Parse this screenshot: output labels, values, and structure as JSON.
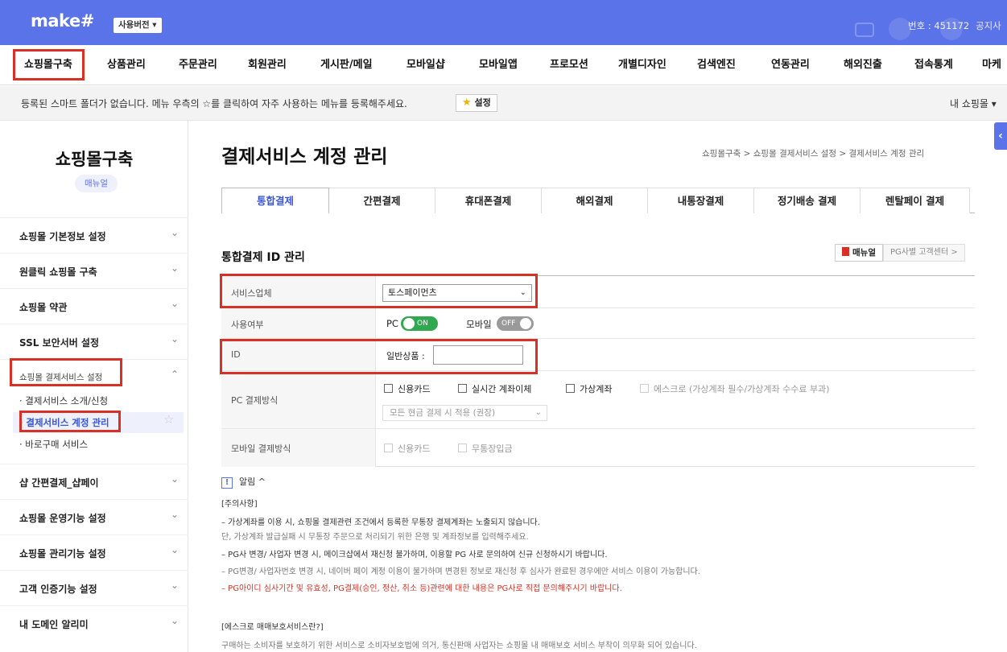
{
  "topbar": {
    "logo": "make#",
    "version_badge": "사용버전 ▾",
    "number": "번호 : 451172",
    "notice": "공지사"
  },
  "mainnav": {
    "items": [
      "쇼핑몰구축",
      "상품관리",
      "주문관리",
      "회원관리",
      "게시판/메일",
      "모바일샵",
      "모바일앱",
      "프로모션",
      "개별디자인",
      "검색엔진",
      "연동관리",
      "해외진출",
      "접속통계",
      "마케"
    ]
  },
  "smartbar": {
    "message": "등록된 스마트 폴더가 없습니다. 메뉴 우측의 ☆를 클릭하여 자주 사용하는 메뉴를 등록해주세요.",
    "setting_label": "설정",
    "my_shop": "내 쇼핑몰 ▾",
    "collapse_icon": "‹"
  },
  "sidebar": {
    "title": "쇼핑몰구축",
    "manual": "매뉴얼",
    "items": [
      "쇼핑몰 기본정보 설정",
      "원클릭 쇼핑몰 구축",
      "쇼핑몰 약관",
      "SSL 보안서버 설정",
      "쇼핑몰 결제서비스 설정",
      "샵 간편결제_샵페이",
      "쇼핑몰 운영기능 설정",
      "쇼핑몰 관리기능 설정",
      "고객 인증기능 설정",
      "내 도메인 알리미"
    ],
    "subitems": [
      "· 결제서비스 소개/신청",
      "· 결제서비스 계정 관리",
      "· 바로구매 서비스"
    ]
  },
  "content": {
    "title": "결제서비스 계정 관리",
    "breadcrumb": "쇼핑몰구축 > 쇼핑몰 결제서비스 설정 > 결제서비스 계정 관리",
    "tabs": [
      "통합결제",
      "간편결제",
      "휴대폰결제",
      "해외결제",
      "내통장결제",
      "정기배송 결제",
      "렌탈페이 결제"
    ],
    "section_title": "통합결제 ID 관리",
    "manual_btn": "매뉴얼",
    "pg_btn": "PG사별 고객센터 >",
    "form": {
      "service_label": "서비스업체",
      "service_value": "토스페이먼츠",
      "usage_label": "사용여부",
      "pc_label": "PC",
      "pc_toggle": "ON",
      "mobile_label": "모바일",
      "mobile_toggle": "OFF",
      "id_label": "ID",
      "id_field_label": "일반상품 :",
      "id_value": "",
      "pc_pay_label": "PC 결제방식",
      "pc_options": [
        "신용카드",
        "실시간 계좌이체",
        "가상계좌",
        "에스크로 (가상계좌 필수/가상계좌 수수료 부과)"
      ],
      "cash_receipt": "모든 현금 결제 시 적용 (권장)",
      "mobile_pay_label": "모바일 결제방식",
      "mobile_options": [
        "신용카드",
        "무통장입금"
      ]
    },
    "notes": {
      "toggle_label": "알림 ^",
      "heading": "[주의사항]",
      "lines": [
        "– 가상계좌를 이용 시, 쇼핑몰 결제관련 조건에서 등록한 무통장 결제계좌는 노출되지 않습니다.",
        "   단, 가상계좌 발급실패 시 무통장 주문으로 처리되기 위한 은행 및 계좌정보를 입력해주세요.",
        "– PG사 변경/ 사업자 변경 시, 메이크샵에서 재신청 불가하며, 이용할 PG 사로 문의하여 신규 신청하시기 바랍니다.",
        "– PG변경/ 사업자번호 변경 시, 네이버 페이 계정 이용이 불가하며 변경된 정보로 재신청 후 심사가 완료된 경우에만 서비스 이용이 가능합니다.",
        "– PG아이디 심사기간 및 유효성, PG결제(승인, 정산, 취소 등)관련에 대한 내용은 PG사로 직접 문의해주시기 바랍니다."
      ],
      "escrow_heading": "[에스크로 매매보호서비스란?]",
      "escrow_line": "구매하는 소비자를 보호하기 위한 서비스로 소비자보호법에 의거, 통신판매 사업자는 쇼핑몰 내 매매보호 서비스 부착이 의무화 되어 있습니다."
    }
  }
}
